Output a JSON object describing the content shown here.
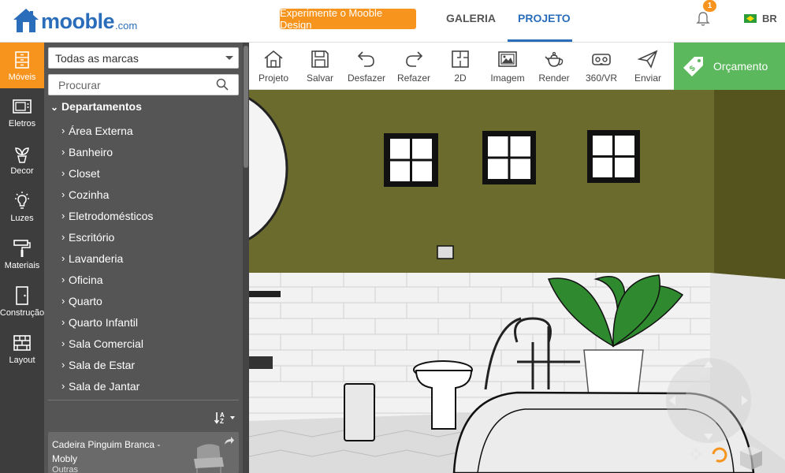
{
  "header": {
    "logo_text": "mooble",
    "logo_suffix": ".com",
    "promo_button": "Experimente o Mooble Design",
    "nav": [
      {
        "label": "GALERIA",
        "active": false
      },
      {
        "label": "PROJETO",
        "active": true
      }
    ],
    "notification_count": "1",
    "language": "BR"
  },
  "sidebar_tools": [
    {
      "label": "Móveis",
      "icon": "furniture-icon",
      "active": true
    },
    {
      "label": "Eletros",
      "icon": "microwave-icon",
      "active": false
    },
    {
      "label": "Decor",
      "icon": "plant-icon",
      "active": false
    },
    {
      "label": "Luzes",
      "icon": "bulb-icon",
      "active": false
    },
    {
      "label": "Materiais",
      "icon": "paint-roller-icon",
      "active": false
    },
    {
      "label": "Construção",
      "icon": "door-icon",
      "active": false
    },
    {
      "label": "Layout",
      "icon": "brick-wall-icon",
      "active": false
    }
  ],
  "catalog": {
    "brand_select": "Todas as marcas",
    "search_placeholder": "Procurar",
    "departments_label": "Departamentos",
    "categories": [
      "Área Externa",
      "Banheiro",
      "Closet",
      "Cozinha",
      "Eletrodomésticos",
      "Escritório",
      "Lavanderia",
      "Oficina",
      "Quarto",
      "Quarto Infantil",
      "Sala Comercial",
      "Sala de Estar",
      "Sala de Jantar"
    ],
    "product": {
      "name": "Cadeira Pinguim Branca - Mobly",
      "brand": "Outras"
    }
  },
  "toolbar": [
    {
      "label": "Projeto",
      "icon": "home-icon"
    },
    {
      "label": "Salvar",
      "icon": "save-icon"
    },
    {
      "label": "Desfazer",
      "icon": "undo-icon"
    },
    {
      "label": "Refazer",
      "icon": "redo-icon"
    },
    {
      "label": "2D",
      "icon": "floorplan-icon"
    },
    {
      "label": "Imagem",
      "icon": "image-icon"
    },
    {
      "label": "Render",
      "icon": "teapot-icon"
    },
    {
      "label": "360/VR",
      "icon": "vr-headset-icon"
    },
    {
      "label": "Enviar",
      "icon": "send-icon"
    }
  ],
  "budget_button": {
    "label": "Orçamento",
    "icon": "price-tag-icon"
  },
  "colors": {
    "brand_blue": "#2a6ebb",
    "accent_orange": "#f7941d",
    "budget_green": "#5cb85c",
    "wall_olive": "#6b6b2d",
    "sidebar_dark": "#3d3d3d",
    "panel_gray": "#555555"
  }
}
